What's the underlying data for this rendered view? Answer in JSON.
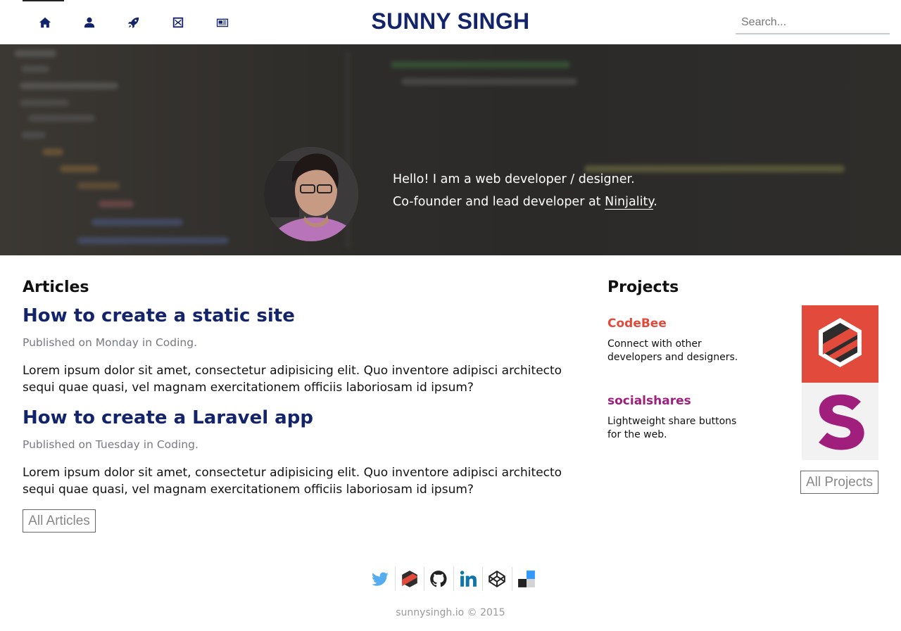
{
  "header": {
    "brand": "SUNNY SINGH",
    "search_placeholder": "Search...",
    "nav": [
      {
        "icon": "home-icon"
      },
      {
        "icon": "user-icon"
      },
      {
        "icon": "rocket-icon"
      },
      {
        "icon": "box-icon"
      },
      {
        "icon": "newspaper-icon"
      }
    ]
  },
  "hero": {
    "line1": "Hello! I am a web developer / designer.",
    "line2_prefix": "Co-founder and lead developer at ",
    "line2_link": "Ninjality",
    "line2_suffix": "."
  },
  "articles": {
    "heading": "Articles",
    "items": [
      {
        "title": "How to create a static site",
        "meta": "Published on Monday in Coding.",
        "body": "Lorem ipsum dolor sit amet, consectetur adipisicing elit. Quo inventore adipisci architecto sequi quae quasi, vel magnam exercitationem officiis laboriosam id ipsum?"
      },
      {
        "title": "How to create a Laravel app",
        "meta": "Published on Tuesday in Coding.",
        "body": "Lorem ipsum dolor sit amet, consectetur adipisicing elit. Quo inventore adipisci architecto sequi quae quasi, vel magnam exercitationem officiis laboriosam id ipsum?"
      }
    ],
    "all_button": "All Articles"
  },
  "projects": {
    "heading": "Projects",
    "items": [
      {
        "name": "CodeBee",
        "desc": "Connect with other developers and designers.",
        "color": "#e24a3b"
      },
      {
        "name": "socialshares",
        "desc": "Lightweight share buttons for the web.",
        "color": "#a01e7c"
      }
    ],
    "all_button": "All Projects"
  },
  "footer": {
    "social": [
      "twitter-icon",
      "codebee-icon",
      "github-icon",
      "linkedin-icon",
      "codepen-icon",
      "delicious-icon"
    ],
    "copyright": "sunnysingh.io © 2015"
  },
  "colors": {
    "brand": "#14246b",
    "codebee": "#e24a3b",
    "socialshares": "#a01e7c"
  }
}
